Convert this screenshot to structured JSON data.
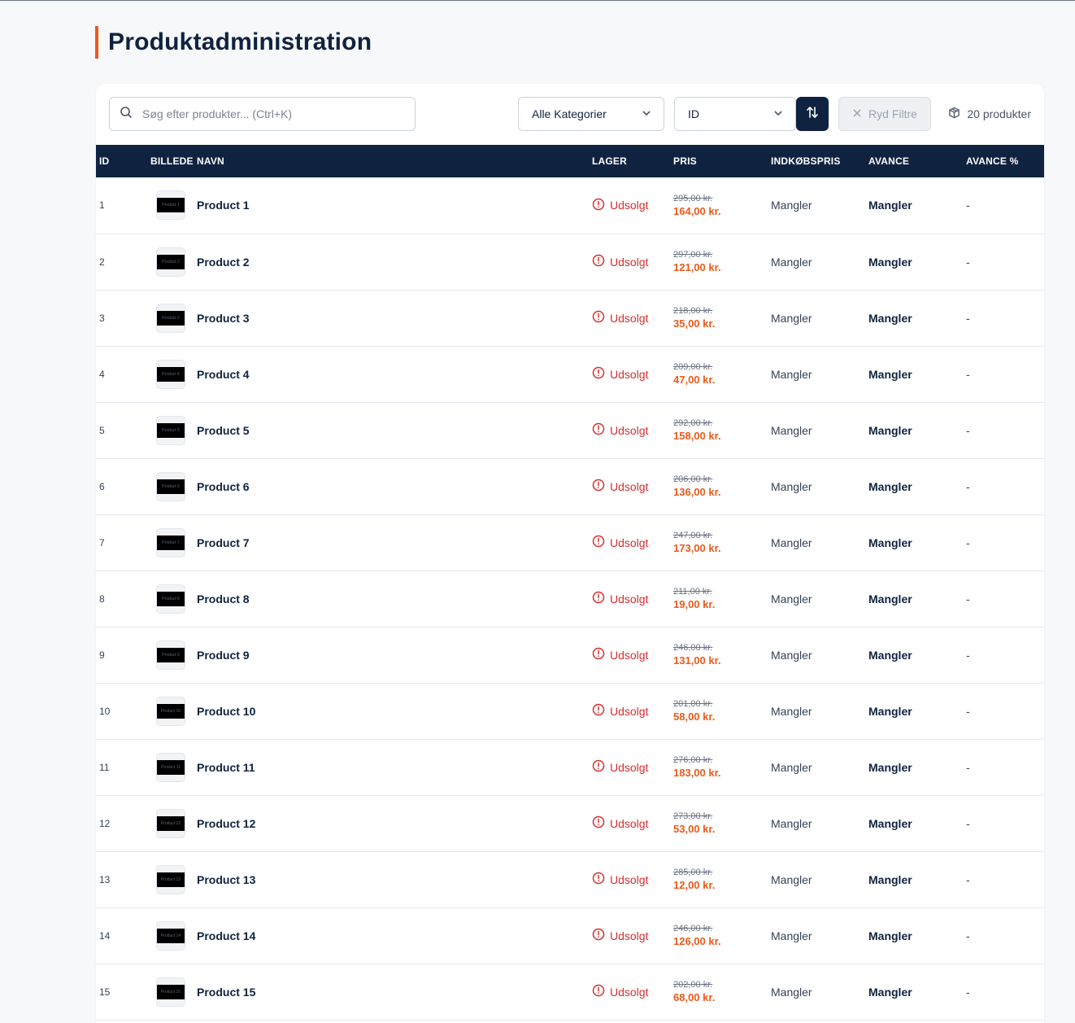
{
  "page": {
    "title": "Produktadministration"
  },
  "toolbar": {
    "search_placeholder": "Søg efter produkter... (Ctrl+K)",
    "category_select": "Alle Kategorier",
    "sort_select": "ID",
    "clear_label": "Ryd Filtre",
    "count_label": "20 produkter"
  },
  "table": {
    "headers": {
      "id": "ID",
      "image": "BILLEDE",
      "name": "NAVN",
      "stock": "LAGER",
      "price": "PRIS",
      "cost": "INDKØBSPRIS",
      "margin": "AVANCE",
      "margin_pct": "AVANCE %"
    },
    "rows": [
      {
        "id": "1",
        "thumb": "Product 1",
        "name": "Product 1",
        "stock": "Udsolgt",
        "old_price": "295,00 kr.",
        "price": "164,00 kr.",
        "cost": "Mangler",
        "margin": "Mangler",
        "margin_pct": "-"
      },
      {
        "id": "2",
        "thumb": "Product 2",
        "name": "Product 2",
        "stock": "Udsolgt",
        "old_price": "297,00 kr.",
        "price": "121,00 kr.",
        "cost": "Mangler",
        "margin": "Mangler",
        "margin_pct": "-"
      },
      {
        "id": "3",
        "thumb": "Product 3",
        "name": "Product 3",
        "stock": "Udsolgt",
        "old_price": "218,00 kr.",
        "price": "35,00 kr.",
        "cost": "Mangler",
        "margin": "Mangler",
        "margin_pct": "-"
      },
      {
        "id": "4",
        "thumb": "Product 4",
        "name": "Product 4",
        "stock": "Udsolgt",
        "old_price": "209,00 kr.",
        "price": "47,00 kr.",
        "cost": "Mangler",
        "margin": "Mangler",
        "margin_pct": "-"
      },
      {
        "id": "5",
        "thumb": "Product 5",
        "name": "Product 5",
        "stock": "Udsolgt",
        "old_price": "292,00 kr.",
        "price": "158,00 kr.",
        "cost": "Mangler",
        "margin": "Mangler",
        "margin_pct": "-"
      },
      {
        "id": "6",
        "thumb": "Product 6",
        "name": "Product 6",
        "stock": "Udsolgt",
        "old_price": "206,00 kr.",
        "price": "136,00 kr.",
        "cost": "Mangler",
        "margin": "Mangler",
        "margin_pct": "-"
      },
      {
        "id": "7",
        "thumb": "Product 7",
        "name": "Product 7",
        "stock": "Udsolgt",
        "old_price": "247,00 kr.",
        "price": "173,00 kr.",
        "cost": "Mangler",
        "margin": "Mangler",
        "margin_pct": "-"
      },
      {
        "id": "8",
        "thumb": "Product 8",
        "name": "Product 8",
        "stock": "Udsolgt",
        "old_price": "211,00 kr.",
        "price": "19,00 kr.",
        "cost": "Mangler",
        "margin": "Mangler",
        "margin_pct": "-"
      },
      {
        "id": "9",
        "thumb": "Product 9",
        "name": "Product 9",
        "stock": "Udsolgt",
        "old_price": "246,00 kr.",
        "price": "131,00 kr.",
        "cost": "Mangler",
        "margin": "Mangler",
        "margin_pct": "-"
      },
      {
        "id": "10",
        "thumb": "Product 10",
        "name": "Product 10",
        "stock": "Udsolgt",
        "old_price": "201,00 kr.",
        "price": "58,00 kr.",
        "cost": "Mangler",
        "margin": "Mangler",
        "margin_pct": "-"
      },
      {
        "id": "11",
        "thumb": "Product 11",
        "name": "Product 11",
        "stock": "Udsolgt",
        "old_price": "276,00 kr.",
        "price": "183,00 kr.",
        "cost": "Mangler",
        "margin": "Mangler",
        "margin_pct": "-"
      },
      {
        "id": "12",
        "thumb": "Product 12",
        "name": "Product 12",
        "stock": "Udsolgt",
        "old_price": "273,00 kr.",
        "price": "53,00 kr.",
        "cost": "Mangler",
        "margin": "Mangler",
        "margin_pct": "-"
      },
      {
        "id": "13",
        "thumb": "Product 13",
        "name": "Product 13",
        "stock": "Udsolgt",
        "old_price": "285,00 kr.",
        "price": "12,00 kr.",
        "cost": "Mangler",
        "margin": "Mangler",
        "margin_pct": "-"
      },
      {
        "id": "14",
        "thumb": "Product 14",
        "name": "Product 14",
        "stock": "Udsolgt",
        "old_price": "246,00 kr.",
        "price": "126,00 kr.",
        "cost": "Mangler",
        "margin": "Mangler",
        "margin_pct": "-"
      },
      {
        "id": "15",
        "thumb": "Product 15",
        "name": "Product 15",
        "stock": "Udsolgt",
        "old_price": "202,00 kr.",
        "price": "68,00 kr.",
        "cost": "Mangler",
        "margin": "Mangler",
        "margin_pct": "-"
      }
    ]
  },
  "colors": {
    "navy": "#0f2340",
    "accent_orange": "#ea5a1c",
    "out_of_stock_red": "#d62f2f"
  },
  "icons": {
    "search": "search-icon",
    "chevron": "chevron-down-icon",
    "sort": "sort-arrows-icon",
    "clear": "close-icon",
    "count": "package-icon",
    "stock": "alert-circle-icon"
  }
}
